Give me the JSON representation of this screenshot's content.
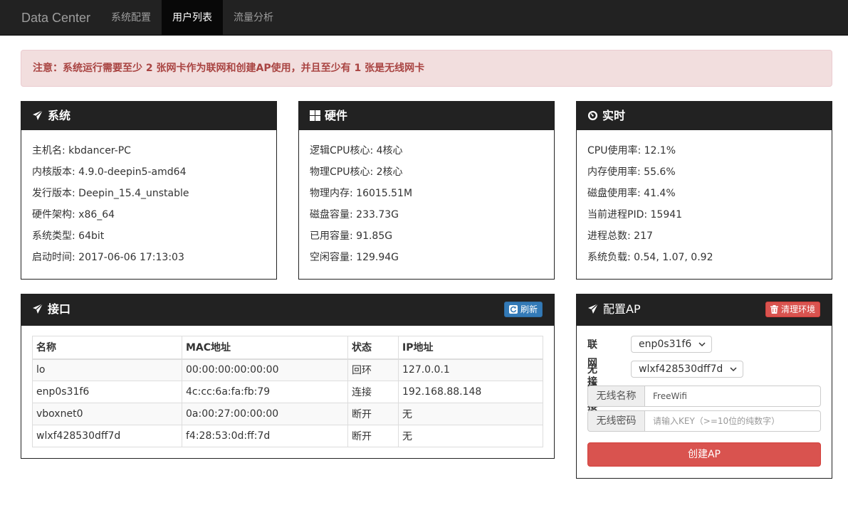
{
  "navbar": {
    "brand": "Data Center",
    "items": [
      {
        "label": "系统配置"
      },
      {
        "label": "用户列表"
      },
      {
        "label": "流量分析"
      }
    ],
    "active_index": 1
  },
  "alert": {
    "text": "注意：系统运行需要至少 2 张网卡作为联网和创建AP使用，并且至少有 1 张是无线网卡"
  },
  "system": {
    "title": "系统",
    "icon": "paper-plane-icon",
    "rows": [
      "主机名: kbdancer-PC",
      "内核版本: 4.9.0-deepin5-amd64",
      "发行版本: Deepin_15.4_unstable",
      "硬件架构: x86_64",
      "系统类型: 64bit",
      "启动时间: 2017-06-06 17:13:03"
    ]
  },
  "hardware": {
    "title": "硬件",
    "icon": "grid-icon",
    "rows": [
      "逻辑CPU核心: 4核心",
      "物理CPU核心: 2核心",
      "物理内存: 16015.51M",
      "磁盘容量: 233.73G",
      "已用容量: 91.85G",
      "空闲容量: 129.94G"
    ]
  },
  "realtime": {
    "title": "实时",
    "icon": "dashboard-icon",
    "rows": [
      "CPU使用率: 12.1%",
      "内存使用率: 55.6%",
      "磁盘使用率: 41.4%",
      "当前进程PID: 15941",
      "进程总数: 217",
      "系统负载: 0.54, 1.07, 0.92"
    ]
  },
  "interfaces": {
    "title": "接口",
    "refresh_label": "刷新",
    "headers": [
      "名称",
      "MAC地址",
      "状态",
      "IP地址"
    ],
    "rows": [
      [
        "lo",
        "00:00:00:00:00:00",
        "回环",
        "127.0.0.1"
      ],
      [
        "enp0s31f6",
        "4c:cc:6a:fa:fb:79",
        "连接",
        "192.168.88.148"
      ],
      [
        "vboxnet0",
        "0a:00:27:00:00:00",
        "断开",
        "无"
      ],
      [
        "wlxf428530dff7d",
        "f4:28:53:0d:ff:7d",
        "断开",
        "无"
      ]
    ]
  },
  "ap": {
    "title": "配置AP",
    "clean_label": "清理环境",
    "wan_label": "联网接口",
    "wan_value": "enp0s31f6",
    "wlan_label": "无线接口",
    "wlan_value": "wlxf428530dff7d",
    "ssid_label": "无线名称",
    "ssid_value": "FreeWifi",
    "key_label": "无线密码",
    "key_placeholder": "请输入KEY（>=10位的纯数字）",
    "create_label": "创建AP"
  },
  "colors": {
    "navbar": "#222222",
    "alert_bg": "#f2dede",
    "alert_text": "#a94442",
    "primary": "#337ab7",
    "danger": "#d9534f"
  }
}
